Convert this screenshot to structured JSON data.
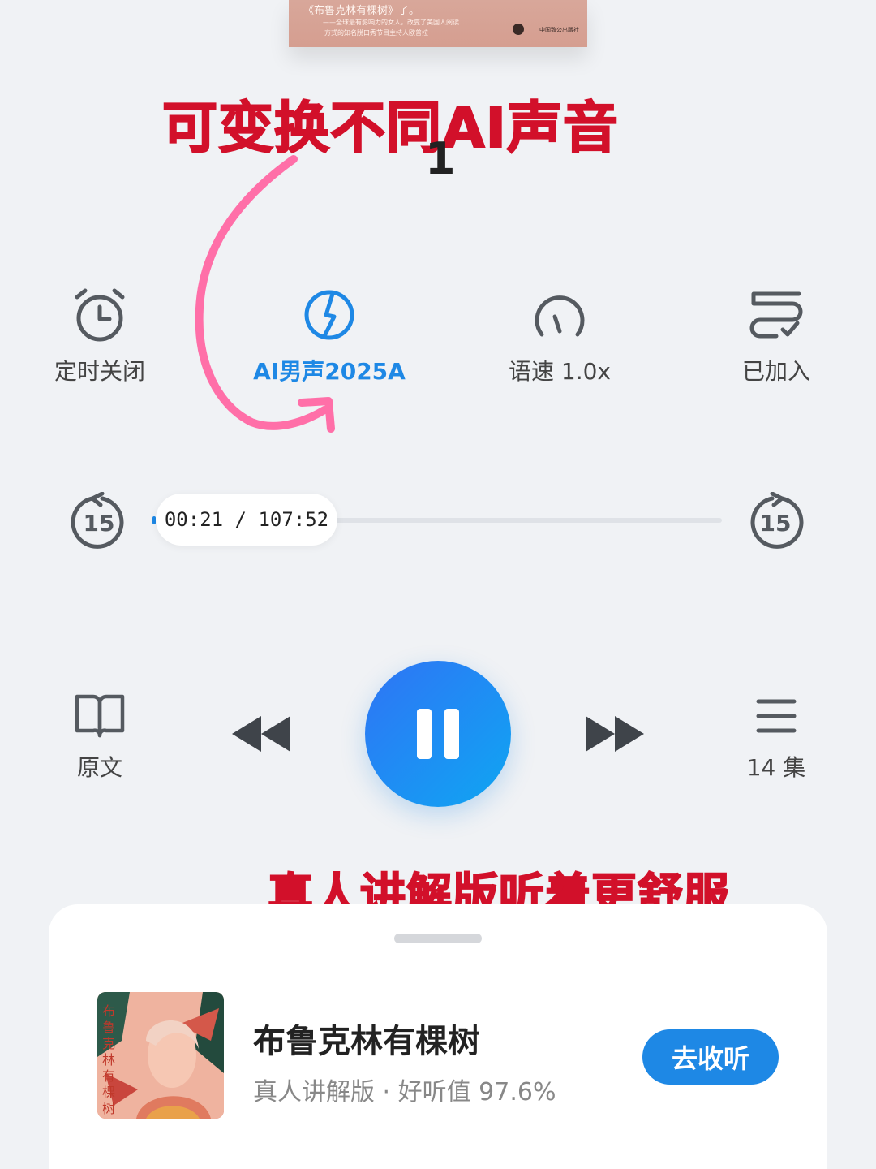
{
  "cover_snippet": {
    "quote": "《布鲁克林有棵树》了。",
    "line1": "——全球最有影响力的女人，改变了美国人阅读",
    "line2": "方式的知名脱口秀节目主持人欧普拉",
    "publisher": "中国致公出版社"
  },
  "annotations": {
    "top": "可变换不同AI声音",
    "top_number": "1",
    "bottom": "真人讲解版听着更舒服",
    "color": "#d2102a",
    "arrow_color": "#ff6fa8"
  },
  "functions": [
    {
      "label": "定时关闭",
      "icon": "alarm-clock-icon"
    },
    {
      "label": "AI男声2025A",
      "icon": "voice-icon",
      "active": true
    },
    {
      "label": "语速 1.0x",
      "icon": "speedometer-icon"
    },
    {
      "label": "已加入",
      "icon": "added-to-list-icon"
    }
  ],
  "progress": {
    "back_skip": "15",
    "forward_skip": "15",
    "time": "00:21 / 107:52",
    "fraction": 0.003
  },
  "controls": {
    "original_text_label": "原文",
    "episodes_label": "14 集",
    "state": "playing"
  },
  "recommendation": {
    "title": "布鲁克林有棵树",
    "subtitle": "真人讲解版 · 好听值 97.6%",
    "button": "去收听",
    "cover_text": "布鲁克林有棵树"
  },
  "colors": {
    "accent": "#1e88e5",
    "background": "#f0f2f5",
    "icon_gray": "#555a60"
  }
}
